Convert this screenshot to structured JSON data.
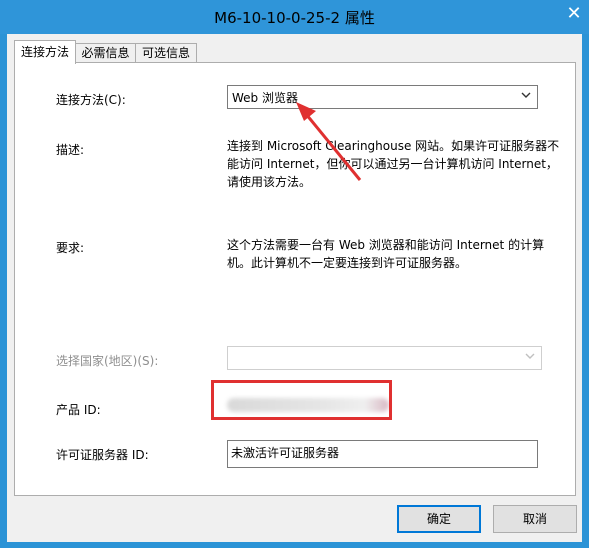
{
  "window": {
    "title": "M6-10-10-0-25-2 属性",
    "close_glyph": "✕"
  },
  "tabs": [
    {
      "label": "连接方法",
      "active": true
    },
    {
      "label": "必需信息",
      "active": false
    },
    {
      "label": "可选信息",
      "active": false
    }
  ],
  "form": {
    "connection_method_label": "连接方法(C):",
    "connection_method_value": "Web 浏览器",
    "description_label": "描述:",
    "description_lines": [
      "连接到 Microsoft Clearinghouse 网站。如果许可证服务器不",
      "能访问 Internet，但你可以通过另一台计算机访问 Internet，",
      "请使用该方法。"
    ],
    "requirement_label": "要求:",
    "requirement_lines": [
      "这个方法需要一台有 Web 浏览器和能访问 Internet 的计算",
      "机。此计算机不一定要连接到许可证服务器。"
    ],
    "country_label": "选择国家(地区)(S):",
    "country_value": "",
    "product_id_label": "产品 ID:",
    "license_server_id_label": "许可证服务器 ID:",
    "license_server_id_value": "未激活许可证服务器"
  },
  "buttons": {
    "ok": "确定",
    "cancel": "取消"
  },
  "annotation_color": "#e03030",
  "accent_color": "#2f95d9"
}
